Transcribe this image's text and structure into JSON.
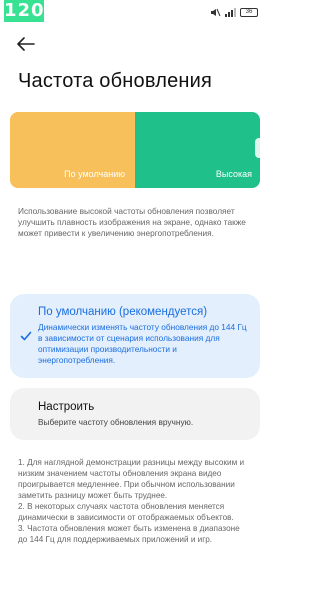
{
  "status_bar": {
    "time": "",
    "hz_badge": "120",
    "battery": "36"
  },
  "header": {
    "title": "Частота обновления"
  },
  "preview": {
    "left_label": "По умолчанию",
    "right_label": "Высокая",
    "left_color": "#f7c05a",
    "right_color": "#20c08a"
  },
  "description": "Использование высокой частоты обновления позволяет улучшить плавность изображения на экране, однако также может привести к увеличению энергопотребления.",
  "options": [
    {
      "title": "По умолчанию (рекомендуется)",
      "subtitle": "Динамически изменять частоту обновления до 144 Гц в зависимости от сценария использования для оптимизации производительности и энергопотребления.",
      "selected": true
    },
    {
      "title": "Настроить",
      "subtitle": "Выберите частоту обновления вручную.",
      "selected": false
    }
  ],
  "notes": [
    "1. Для наглядной демонстрации разницы между высоким и низким значением частоты обновления экрана видео проигрывается медленнее. При обычном использовании заметить разницу может быть труднее.",
    "2. В некоторых случаях частота обновления меняется динамически в зависимости от отображаемых объектов.",
    "3. Частота обновления может быть изменена в диапазоне до 144 Гц для поддерживаемых приложений и игр."
  ],
  "colors": {
    "accent": "#1a6ee0",
    "selected_bg": "#e3effd",
    "unselected_bg": "#f2f2f2"
  }
}
